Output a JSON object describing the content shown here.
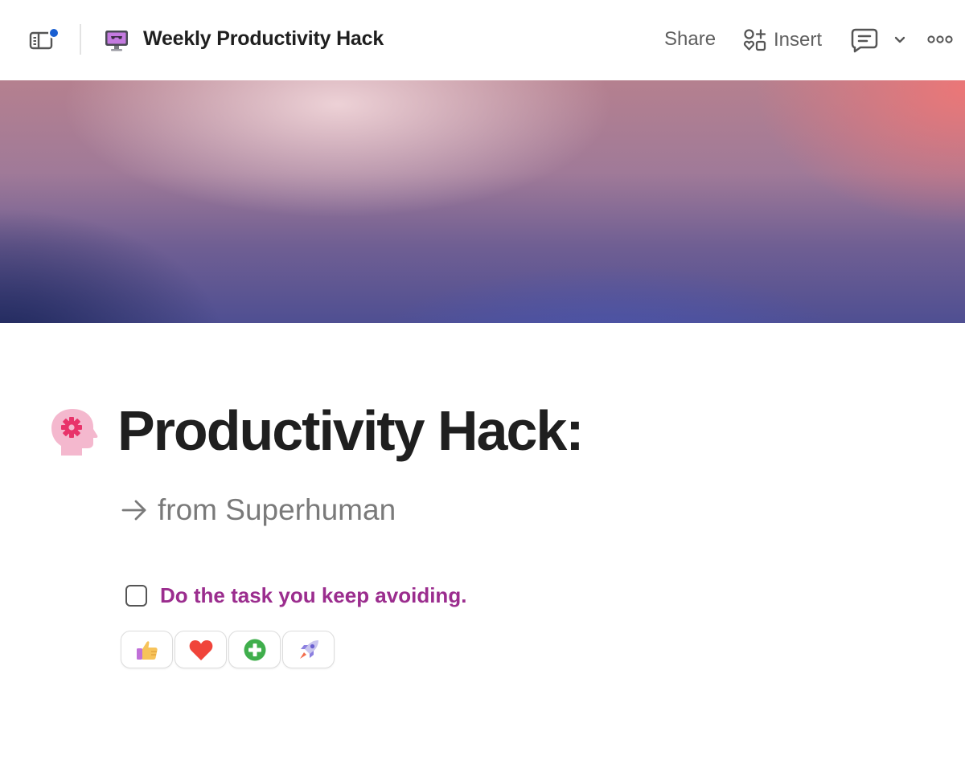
{
  "header": {
    "doc_title": "Weekly Productivity Hack",
    "share_label": "Share",
    "insert_label": "Insert",
    "notification_color": "#1a5fd1"
  },
  "page": {
    "title": "Productivity Hack:",
    "subtitle": "from Superhuman",
    "todo": {
      "text": "Do the task you keep avoiding.",
      "checked": false,
      "color": "#9b2d8e"
    },
    "reactions": [
      {
        "icon": "thumbs-up-icon"
      },
      {
        "icon": "heart-icon"
      },
      {
        "icon": "plus-circle-icon"
      },
      {
        "icon": "rocket-icon"
      }
    ]
  }
}
